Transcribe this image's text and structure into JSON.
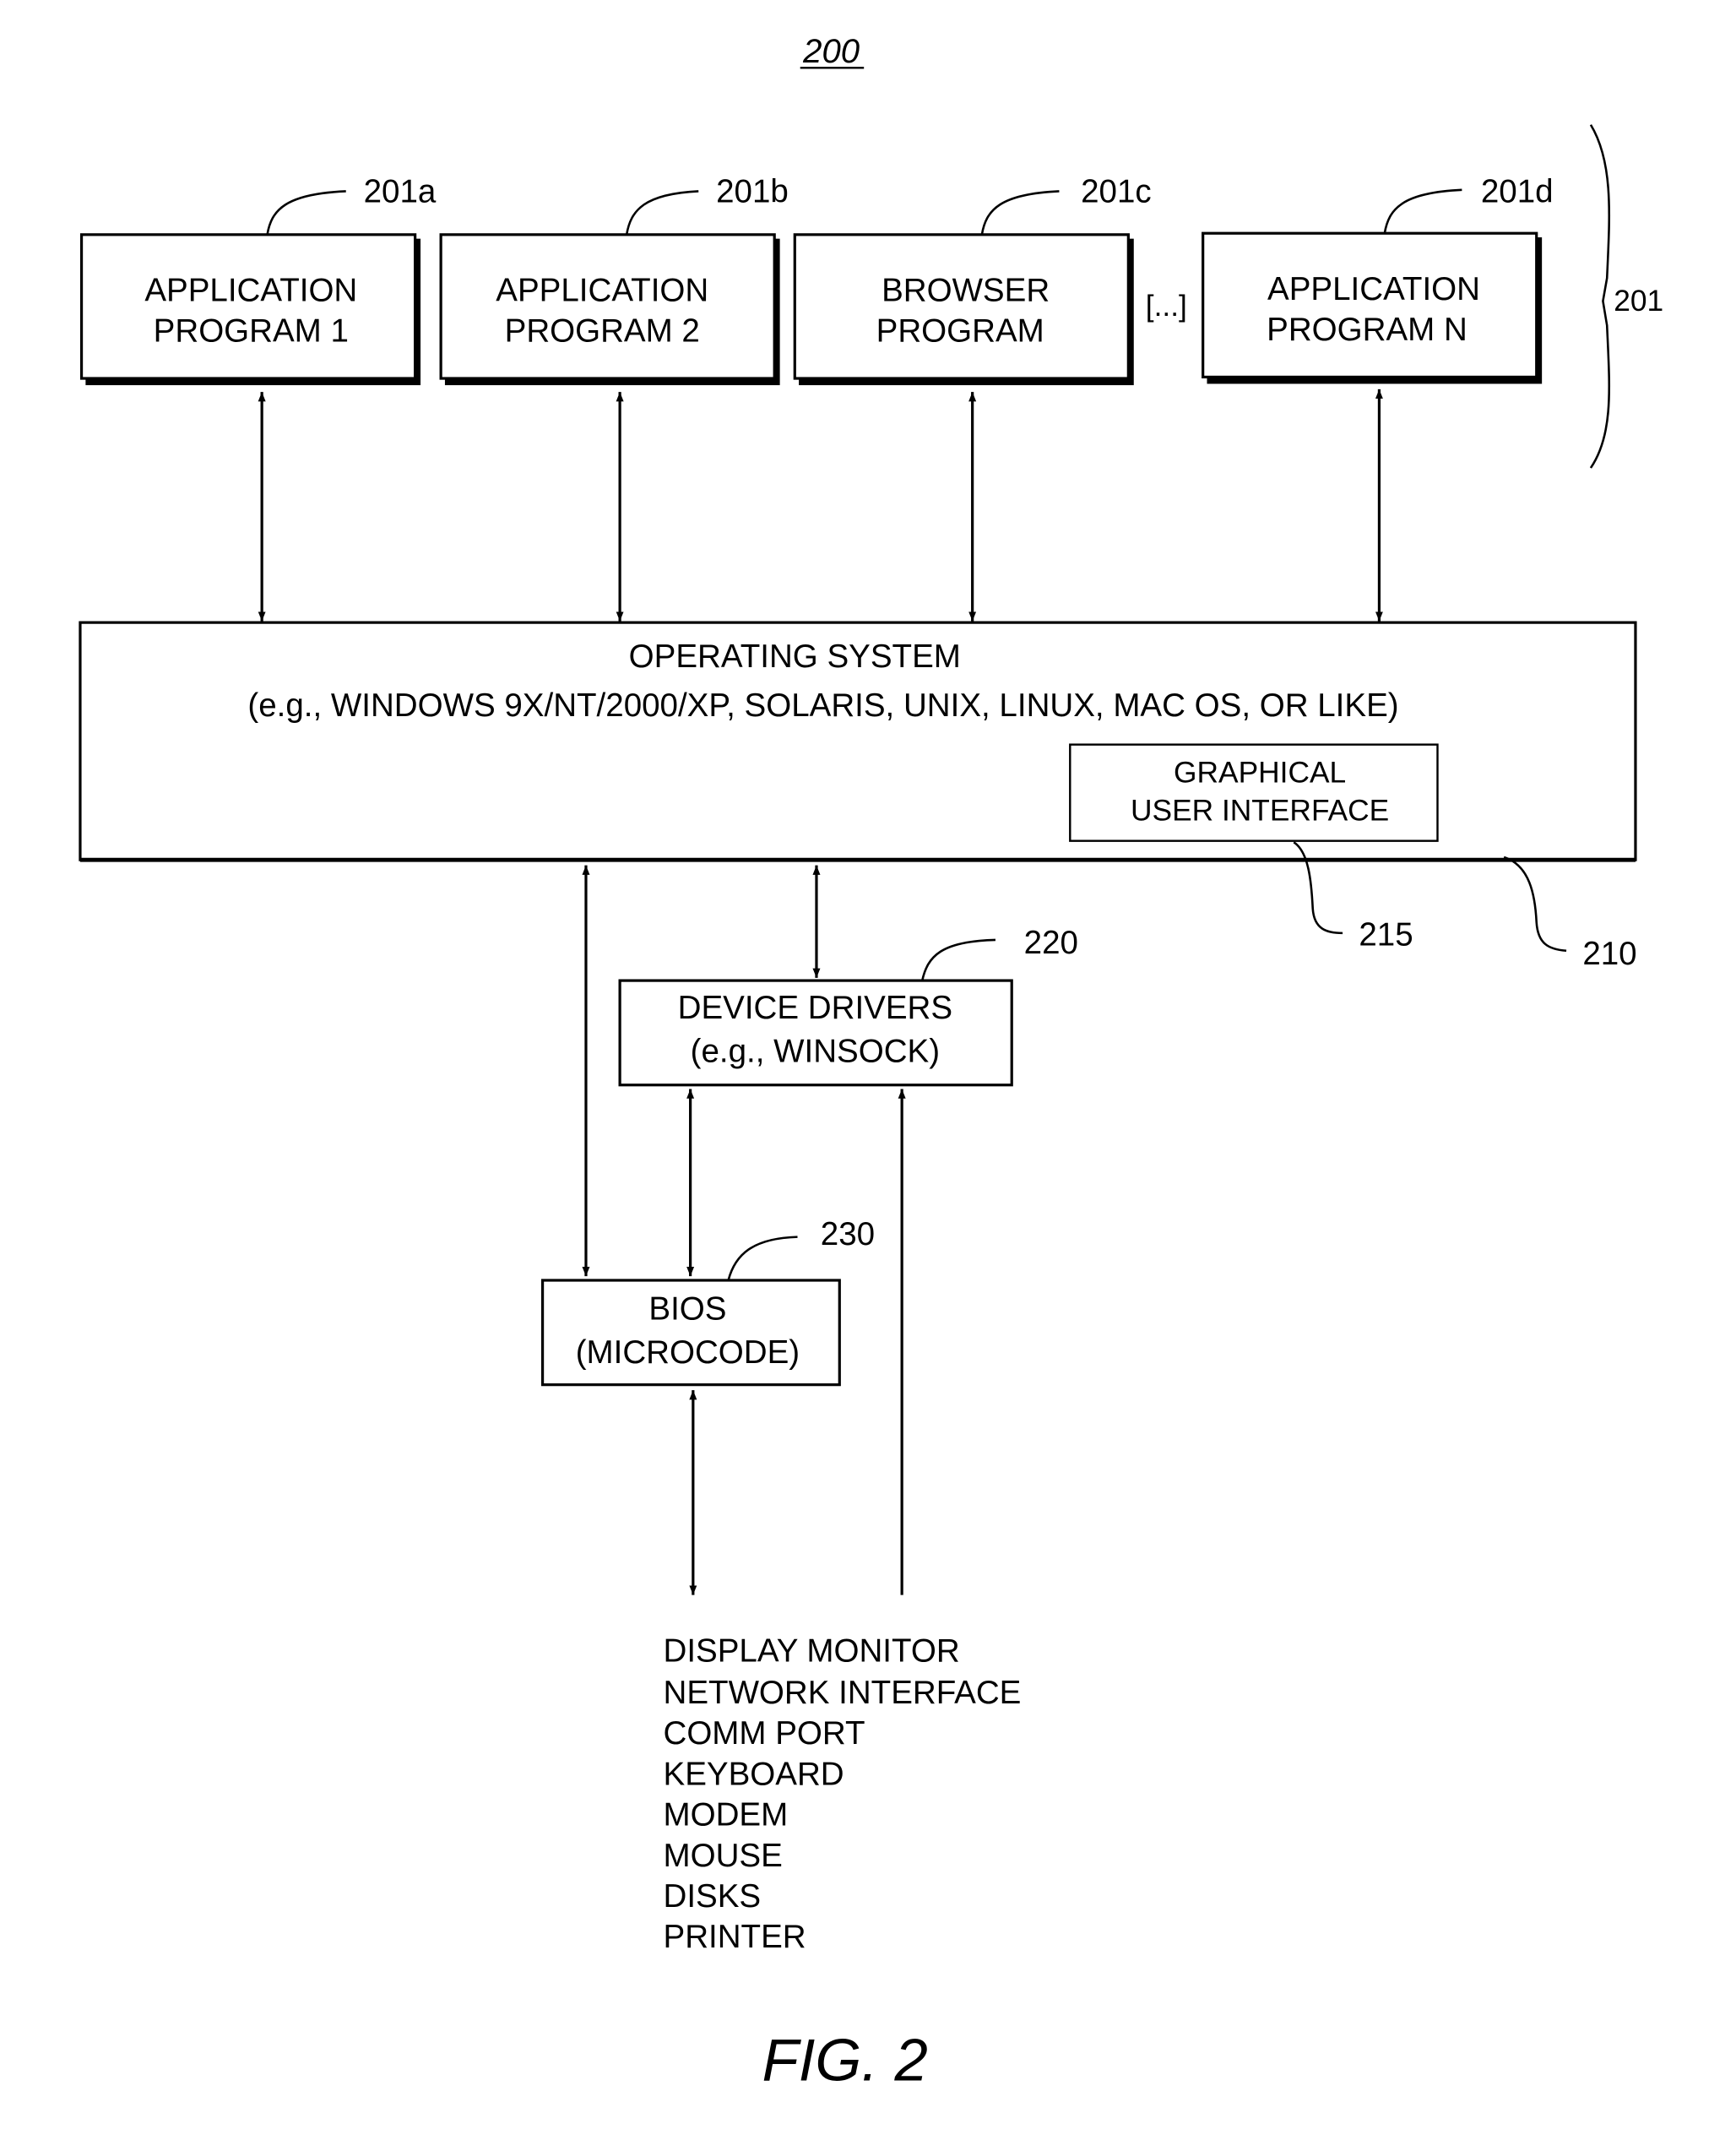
{
  "figure_number": "200",
  "caption": "FIG. 2",
  "group_ref": "201",
  "applications": [
    {
      "ref": "201a",
      "line1": "APPLICATION",
      "line2": "PROGRAM 1"
    },
    {
      "ref": "201b",
      "line1": "APPLICATION",
      "line2": "PROGRAM 2"
    },
    {
      "ref": "201c",
      "line1": "BROWSER",
      "line2": "PROGRAM"
    },
    {
      "ref": "201d",
      "line1": "APPLICATION",
      "line2": "PROGRAM N"
    }
  ],
  "ellipsis": "[...]",
  "os": {
    "ref": "210",
    "title": "OPERATING SYSTEM",
    "subtitle": "(e.g., WINDOWS 9X/NT/2000/XP, SOLARIS, UNIX, LINUX, MAC OS, OR LIKE)",
    "gui": {
      "ref": "215",
      "line1": "GRAPHICAL",
      "line2": "USER INTERFACE"
    }
  },
  "drivers": {
    "ref": "220",
    "line1": "DEVICE DRIVERS",
    "line2": "(e.g., WINSOCK)"
  },
  "bios": {
    "ref": "230",
    "line1": "BIOS",
    "line2": "(MICROCODE)"
  },
  "devices": [
    "DISPLAY MONITOR",
    "NETWORK INTERFACE",
    "COMM PORT",
    "KEYBOARD",
    "MODEM",
    "MOUSE",
    "DISKS",
    "PRINTER"
  ]
}
